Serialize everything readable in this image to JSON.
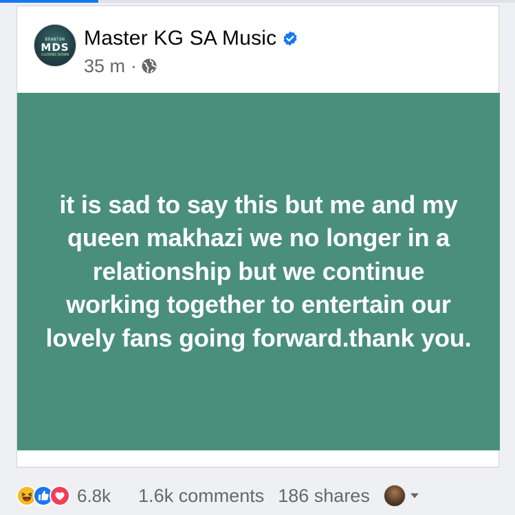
{
  "post": {
    "page_name": "Master KG SA Music",
    "time_ago": "35 m",
    "separator": "·",
    "audience_icon": "globe-icon",
    "verified_icon": "verified-badge-icon",
    "text": "it is sad to say this but me and my queen makhazi we no longer in a relationship but we continue working together to entertain our lovely fans going forward.thank you.",
    "background_color": "#4a8f7b",
    "avatar": {
      "top_text": "BRANTON",
      "main_text": "MDS",
      "sub_text": "CLOSING DOWN"
    }
  },
  "footer": {
    "reaction_icons": [
      "haha-icon",
      "like-icon",
      "love-icon"
    ],
    "reaction_count": "6.8k",
    "comments": "1.6k comments",
    "shares": "186 shares",
    "viewer_avatar": "avatar",
    "audience_selector_icon": "caret-down-icon"
  },
  "colors": {
    "accent": "#1877f2",
    "secondary_text": "#65676b",
    "haha": "#f7b928",
    "love": "#f33e58"
  }
}
